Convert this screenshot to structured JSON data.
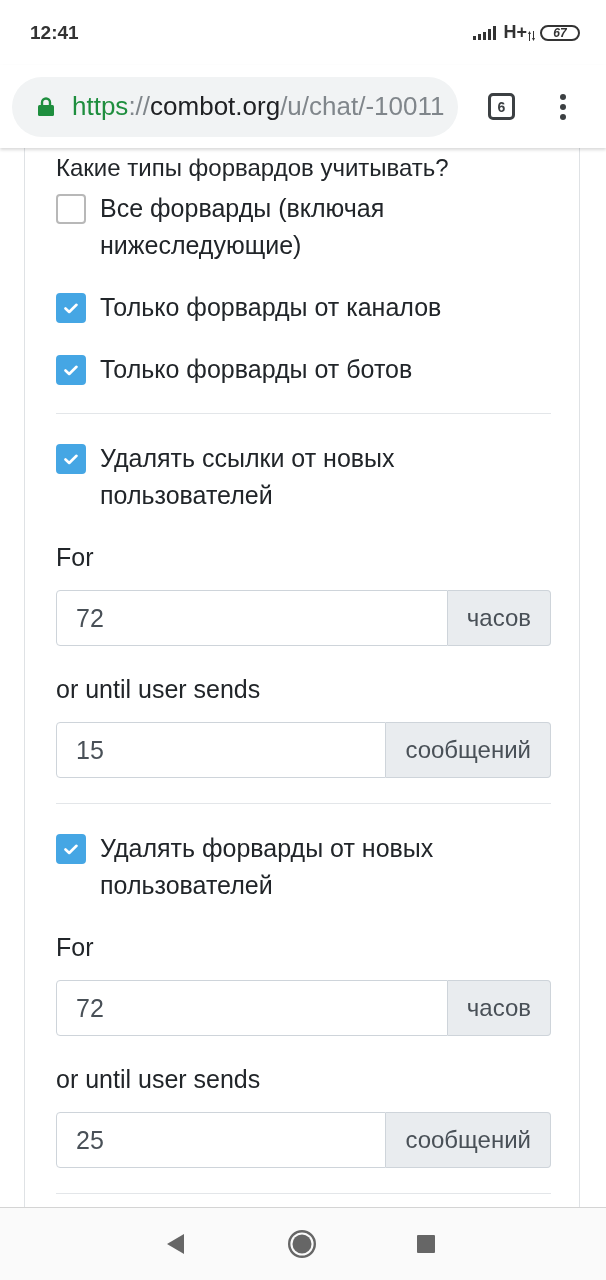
{
  "status_bar": {
    "time": "12:41",
    "network": "H+",
    "battery": "67"
  },
  "browser_toolbar": {
    "url": {
      "scheme": "https",
      "separator": "://",
      "host": "combot.org",
      "path": "/u/chat/-10011"
    },
    "tab_count": "6"
  },
  "sections": [
    {
      "heading": "Какие типы форвардов учитывать?",
      "options": [
        {
          "label": "Все форварды (включая нижеследующие)",
          "checked": false
        },
        {
          "label": "Только форварды от каналов",
          "checked": true
        },
        {
          "label": "Только форварды от ботов",
          "checked": true
        }
      ]
    },
    {
      "options": [
        {
          "label": "Удалять ссылки от новых пользователей",
          "checked": true
        }
      ],
      "fields": [
        {
          "label": "For",
          "value": "72",
          "unit": "часов"
        },
        {
          "label": "or until user sends",
          "value": "15",
          "unit": "сообщений"
        }
      ]
    },
    {
      "options": [
        {
          "label": "Удалять форварды от новых пользователей",
          "checked": true
        }
      ],
      "fields": [
        {
          "label": "For",
          "value": "72",
          "unit": "часов"
        },
        {
          "label": "or until user sends",
          "value": "25",
          "unit": "сообщений"
        }
      ]
    }
  ]
}
